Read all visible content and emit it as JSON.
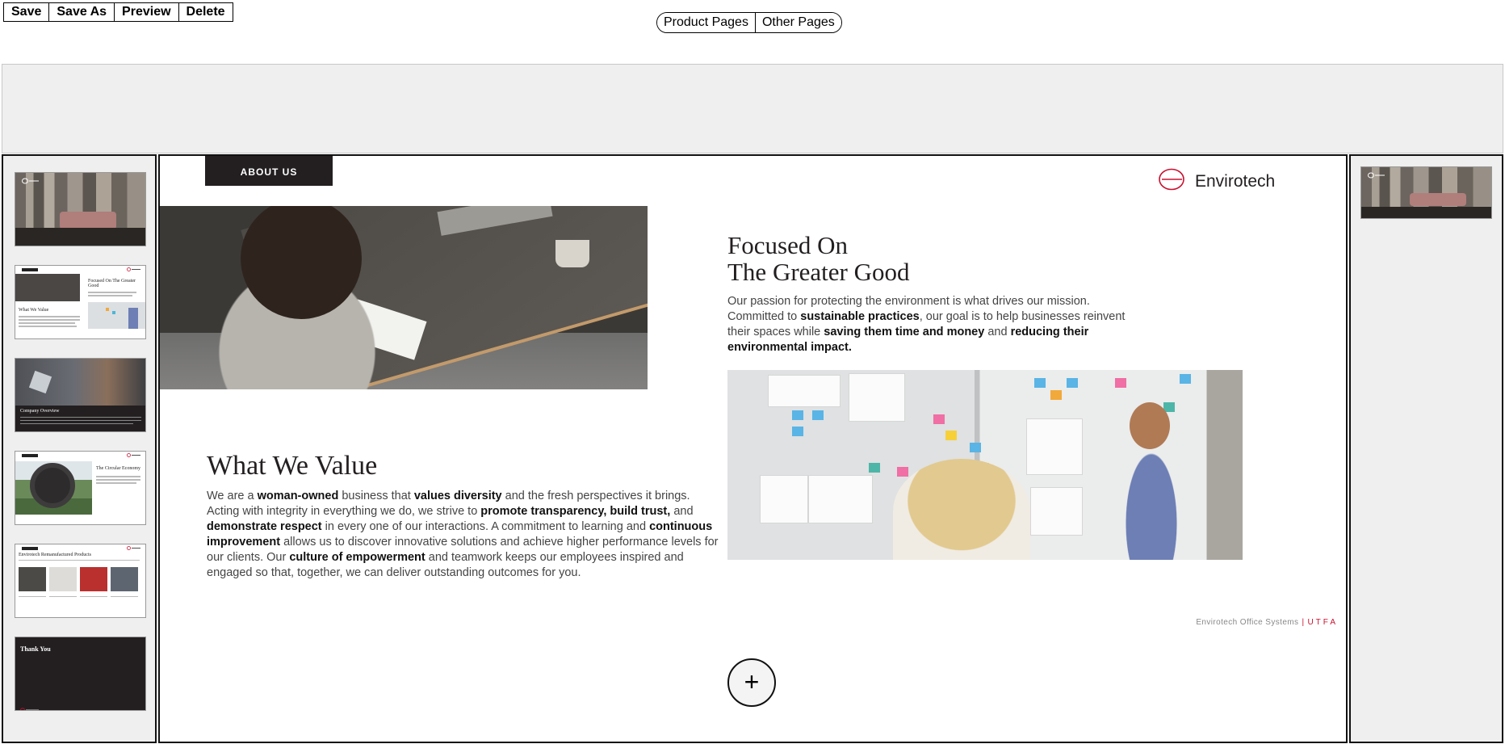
{
  "toolbar": {
    "save": "Save",
    "save_as": "Save As",
    "preview": "Preview",
    "delete": "Delete"
  },
  "page_tabs": {
    "product_pages": "Product Pages",
    "other_pages": "Other Pages"
  },
  "thumbnails": {
    "slide2_title": "Focused On The Greater Good",
    "slide2_subtitle": "What We Value",
    "slide3_title": "Company Overview",
    "slide4_title": "The Circular Economy",
    "slide5_title": "Envirotech Remanufactured Products",
    "slide6_title": "Thank You"
  },
  "slide": {
    "tag": "ABOUT US",
    "brand": "Envirotech",
    "brand_color": "#c8102e",
    "focus_title_line1": "Focused On",
    "focus_title_line2": "The Greater Good",
    "focus_p": [
      "Our passion for protecting the environment is what drives our mission. Committed to ",
      "sustainable practices",
      ", our goal is to help businesses reinvent their spaces while ",
      "saving them time and money",
      " and ",
      "reducing their environmental impact."
    ],
    "value_title": "What We Value",
    "value_p": [
      "We are a ",
      "woman-owned",
      " business that ",
      "values diversity",
      " and the fresh perspectives it brings. Acting with integrity in everything we do, we strive to ",
      "promote transparency, build trust,",
      " and ",
      "demonstrate respect",
      " in every one of our interactions. A commitment to learning and ",
      "continuous improvement",
      " allows us to discover innovative solutions and achieve higher performance levels for our clients. Our ",
      "culture of empowerment",
      " and teamwork keeps our employees inspired and engaged so that, together, we can deliver outstanding outcomes for you."
    ],
    "footer_company": "Envirotech Office Systems",
    "footer_sep": "|",
    "footer_tag": "UTFA"
  },
  "add_button": "+"
}
